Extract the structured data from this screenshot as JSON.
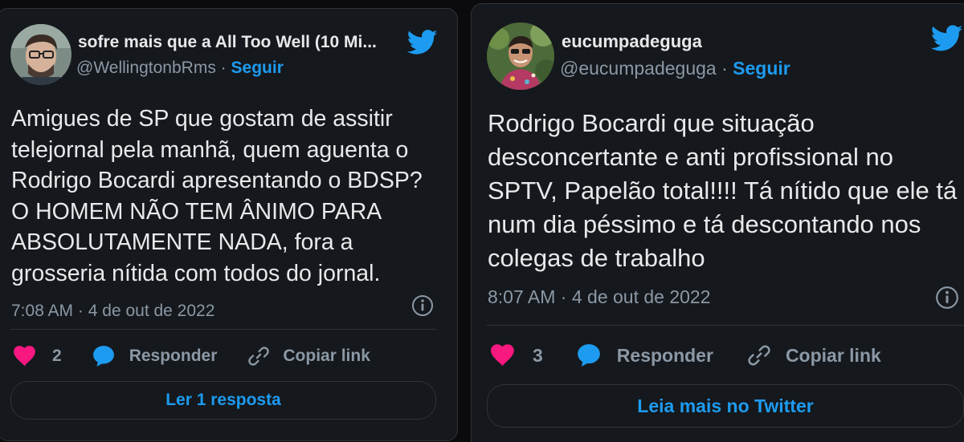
{
  "tweets": [
    {
      "author_name": "sofre mais que a All Too Well (10 Mi...",
      "handle": "@WellingtonbRms",
      "separator": "·",
      "follow_label": "Seguir",
      "text": "Amigues de SP que gostam de assitir telejornal pela manhã, quem aguenta o Rodrigo Bocardi apresentando o BDSP? O HOMEM NÃO TEM ÂNIMO PARA ABSOLUTAMENTE NADA, fora a grosseria nítida com todos do jornal.",
      "time": "7:08 AM",
      "date": "4 de out de 2022",
      "like_count": "2",
      "reply_label": "Responder",
      "copy_label": "Copiar link",
      "bottom_button_label": "Ler 1 resposta"
    },
    {
      "author_name": "eucumpadeguga",
      "handle": "@eucumpadeguga",
      "separator": "·",
      "follow_label": "Seguir",
      "text": "Rodrigo Bocardi que situação desconcertante e anti profissional no SPTV, Papelão total!!!! Tá nítido que ele tá num dia péssimo e tá descontando nos colegas de trabalho",
      "time": "8:07 AM",
      "date": "4 de out de 2022",
      "like_count": "3",
      "reply_label": "Responder",
      "copy_label": "Copiar link",
      "bottom_button_label": "Leia mais no Twitter"
    }
  ],
  "icons": {
    "logo": "twitter-bird-icon",
    "like": "heart-icon",
    "reply": "speech-bubble-icon",
    "copy": "link-icon",
    "info": "info-icon"
  },
  "colors": {
    "accent": "#1d9bf0",
    "like": "#f91880",
    "background": "#15181c",
    "secondary_text": "#8b98a5"
  }
}
